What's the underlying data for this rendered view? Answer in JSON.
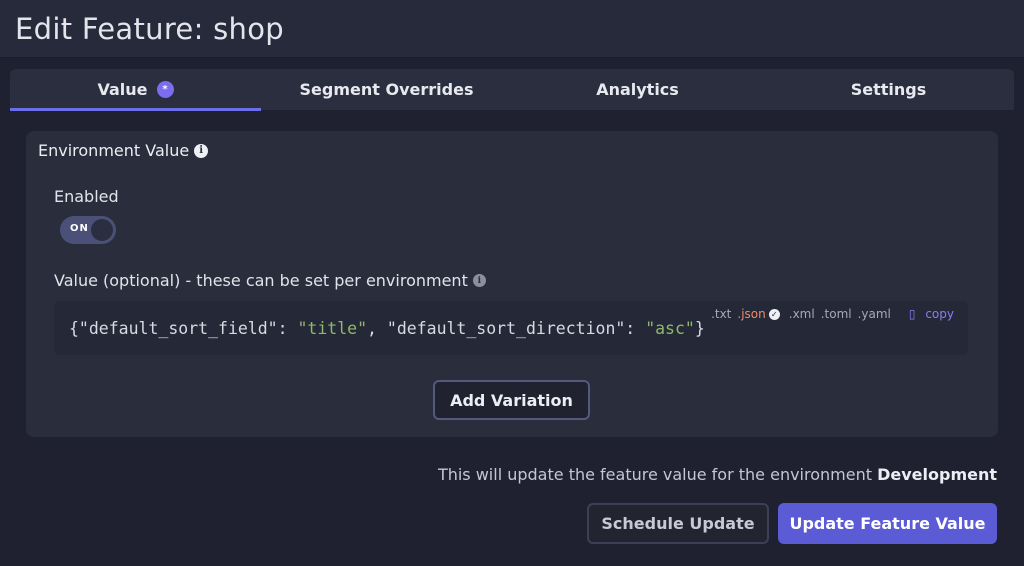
{
  "header": {
    "title": "Edit Feature: shop"
  },
  "tabs": [
    {
      "label": "Value",
      "badge": "*"
    },
    {
      "label": "Segment Overrides"
    },
    {
      "label": "Analytics"
    },
    {
      "label": "Settings"
    }
  ],
  "panel": {
    "title": "Environment Value",
    "enabled_label": "Enabled",
    "toggle_text": "ON",
    "value_label": "Value (optional) - these can be set per environment",
    "code": {
      "p1": "{\"default_sort_field\": ",
      "s1": "\"title\"",
      "p2": ", \"default_sort_direction\": ",
      "s2": "\"asc\"",
      "p3": "}"
    },
    "formats": [
      ".txt",
      ".json",
      ".xml",
      ".toml",
      ".yaml"
    ],
    "copy_label": "copy",
    "add_variation_label": "Add Variation"
  },
  "footer": {
    "notice_prefix": "This will update the feature value for the environment",
    "environment": "Development",
    "schedule_label": "Schedule Update",
    "update_label": "Update Feature Value"
  },
  "colors": {
    "accent": "#5c5bd6",
    "active_format": "#f08a6c",
    "string": "#8fb86a"
  }
}
